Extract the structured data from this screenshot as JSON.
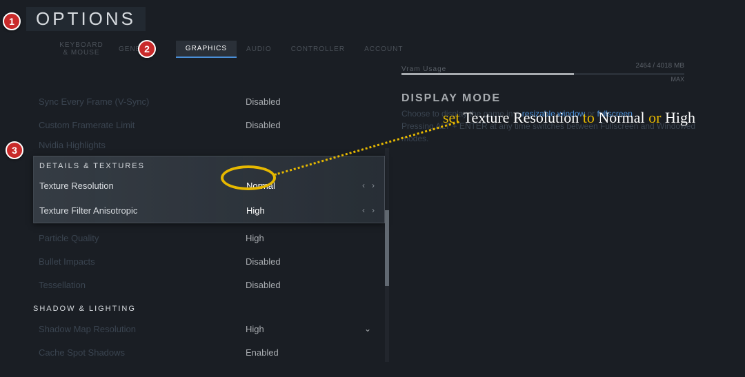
{
  "title": "OPTIONS",
  "tabs": {
    "keyboard_mouse": "KEYBOARD & MOUSE",
    "general": "GENERAL",
    "graphics": "GRAPHICS",
    "audio": "AUDIO",
    "controller": "CONTROLLER",
    "account": "ACCOUNT"
  },
  "settings": {
    "sync_every_frame": {
      "label": "Sync Every Frame (V-Sync)",
      "value": "Disabled"
    },
    "custom_framerate": {
      "label": "Custom Framerate Limit",
      "value": "Disabled"
    },
    "nvidia_highlights": {
      "label": "Nvidia Highlights",
      "value": ""
    },
    "texture_resolution": {
      "label": "Texture Resolution",
      "value": "Normal"
    },
    "texture_filter": {
      "label": "Texture Filter Anisotropic",
      "value": "High"
    },
    "particle_quality": {
      "label": "Particle Quality",
      "value": "High"
    },
    "bullet_impacts": {
      "label": "Bullet Impacts",
      "value": "Disabled"
    },
    "tessellation": {
      "label": "Tessellation",
      "value": "Disabled"
    },
    "shadow_map": {
      "label": "Shadow Map Resolution",
      "value": "High"
    },
    "cache_spot": {
      "label": "Cache Spot Shadows",
      "value": "Enabled"
    }
  },
  "sections": {
    "details_textures": "DETAILS & TEXTURES",
    "shadow_lighting": "SHADOW & LIGHTING"
  },
  "vram": {
    "label": "Vram Usage",
    "value": "2464 / 4018 MB",
    "max": "MAX"
  },
  "display_mode": {
    "title": "DISPLAY MODE",
    "desc1": "Choose to display the game in a ",
    "link1": "resizable window",
    "or": " or ",
    "link2": "fullscreen",
    "desc2": "Pressing ALT + ENTER at any time switches between Fullscreen and Windowed modes."
  },
  "annotation": {
    "w1": "set",
    "w2": "Texture Resolution",
    "w3": "to",
    "w4": "Normal",
    "w5": "or",
    "w6": "High"
  },
  "badges": {
    "b1": "1",
    "b2": "2",
    "b3": "3"
  }
}
